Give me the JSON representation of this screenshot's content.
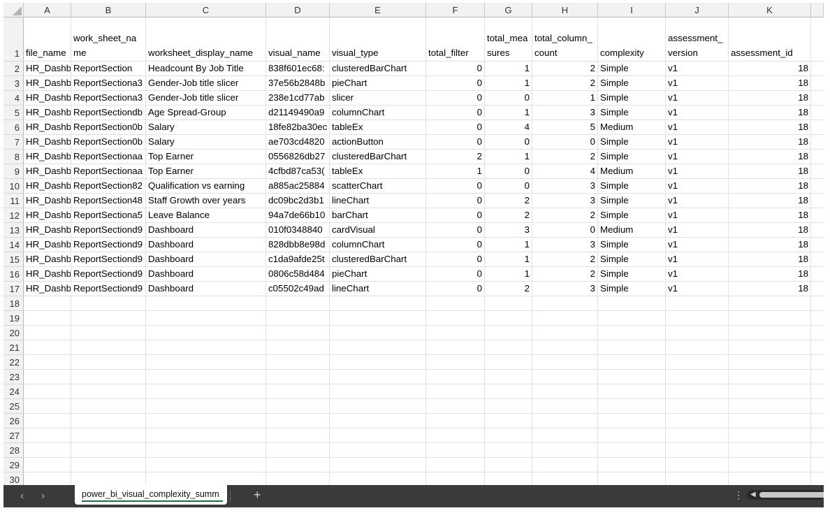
{
  "columns": [
    "A",
    "B",
    "C",
    "D",
    "E",
    "F",
    "G",
    "H",
    "I",
    "J",
    "K"
  ],
  "header_row": [
    "file_name",
    "work_sheet_name",
    "worksheet_display_name",
    "visual_name",
    "visual_type",
    "total_filter",
    "total_measures",
    "total_column_count",
    "complexity",
    "assessment_version",
    "assessment_id"
  ],
  "rows": [
    [
      "HR_Dashb",
      "ReportSection",
      "Headcount By Job Title",
      "838f601ec68:",
      "clusteredBarChart",
      "0",
      "1",
      "2",
      "Simple",
      "v1",
      "18"
    ],
    [
      "HR_Dashb",
      "ReportSectiona3",
      "Gender-Job title slicer",
      "37e56b2848b",
      "pieChart",
      "0",
      "1",
      "2",
      "Simple",
      "v1",
      "18"
    ],
    [
      "HR_Dashb",
      "ReportSectiona3",
      "Gender-Job title slicer",
      "238e1cd77ab",
      "slicer",
      "0",
      "0",
      "1",
      "Simple",
      "v1",
      "18"
    ],
    [
      "HR_Dashb",
      "ReportSectiondb",
      "Age Spread-Group",
      "d21149490a9",
      "columnChart",
      "0",
      "1",
      "3",
      "Simple",
      "v1",
      "18"
    ],
    [
      "HR_Dashb",
      "ReportSection0b",
      "Salary",
      "18fe82ba30ec",
      "tableEx",
      "0",
      "4",
      "5",
      "Medium",
      "v1",
      "18"
    ],
    [
      "HR_Dashb",
      "ReportSection0b",
      "Salary",
      "ae703cd4820",
      "actionButton",
      "0",
      "0",
      "0",
      "Simple",
      "v1",
      "18"
    ],
    [
      "HR_Dashb",
      "ReportSectionaa",
      "Top Earner",
      "0556826db27",
      "clusteredBarChart",
      "2",
      "1",
      "2",
      "Simple",
      "v1",
      "18"
    ],
    [
      "HR_Dashb",
      "ReportSectionaa",
      "Top Earner",
      "4cfbd87ca53(",
      "tableEx",
      "1",
      "0",
      "4",
      "Medium",
      "v1",
      "18"
    ],
    [
      "HR_Dashb",
      "ReportSection82",
      "Qualification vs earning",
      "a885ac25884",
      "scatterChart",
      "0",
      "0",
      "3",
      "Simple",
      "v1",
      "18"
    ],
    [
      "HR_Dashb",
      "ReportSection48",
      "Staff Growth over years",
      "dc09bc2d3b1",
      "lineChart",
      "0",
      "2",
      "3",
      "Simple",
      "v1",
      "18"
    ],
    [
      "HR_Dashb",
      "ReportSectiona5",
      "Leave Balance",
      "94a7de66b10",
      "barChart",
      "0",
      "2",
      "2",
      "Simple",
      "v1",
      "18"
    ],
    [
      "HR_Dashb",
      "ReportSectiond9",
      "Dashboard",
      "010f0348840",
      "cardVisual",
      "0",
      "3",
      "0",
      "Medium",
      "v1",
      "18"
    ],
    [
      "HR_Dashb",
      "ReportSectiond9",
      "Dashboard",
      "828dbb8e98d",
      "columnChart",
      "0",
      "1",
      "3",
      "Simple",
      "v1",
      "18"
    ],
    [
      "HR_Dashb",
      "ReportSectiond9",
      "Dashboard",
      "c1da9afde25t",
      "clusteredBarChart",
      "0",
      "1",
      "2",
      "Simple",
      "v1",
      "18"
    ],
    [
      "HR_Dashb",
      "ReportSectiond9",
      "Dashboard",
      "0806c58d484",
      "pieChart",
      "0",
      "1",
      "2",
      "Simple",
      "v1",
      "18"
    ],
    [
      "HR_Dashb",
      "ReportSectiond9",
      "Dashboard",
      "c05502c49ad",
      "lineChart",
      "0",
      "2",
      "3",
      "Simple",
      "v1",
      "18"
    ]
  ],
  "row_numbers": [
    "1",
    "2",
    "3",
    "4",
    "5",
    "6",
    "7",
    "8",
    "9",
    "10",
    "11",
    "12",
    "13",
    "14",
    "15",
    "16",
    "17",
    "18",
    "19",
    "20",
    "21",
    "22",
    "23",
    "24",
    "25",
    "26",
    "27",
    "28",
    "29",
    "30"
  ],
  "numeric_columns": [
    5,
    6,
    7,
    10
  ],
  "tabbar": {
    "prev_sheet": "‹",
    "next_sheet": "›",
    "sheet_tab_label": "power_bi_visual_complexity_summ",
    "add_sheet": "+",
    "more_options": "⋮",
    "scroll_left": "◀"
  },
  "colors": {
    "header_bg": "#f2f2f2",
    "tabbar_bg": "#3a3a3a",
    "active_tab_underline": "#1e7145"
  }
}
